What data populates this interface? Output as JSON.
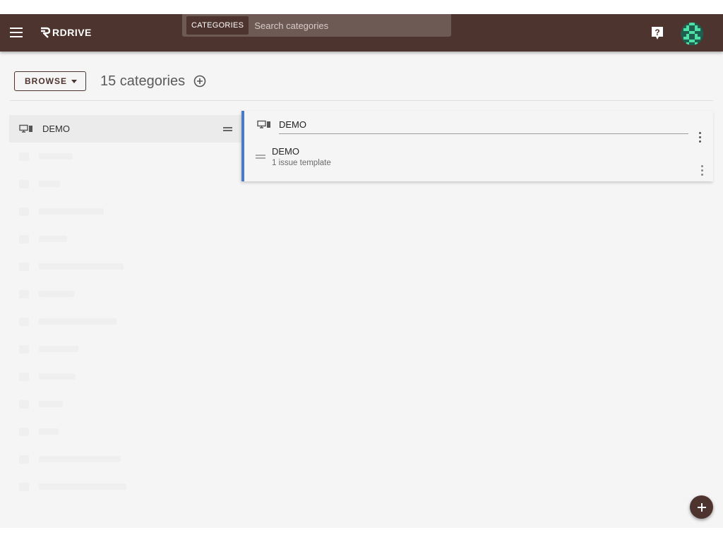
{
  "header": {
    "logo_text": "RDRIVE",
    "search_chip": "CATEGORIES",
    "search_placeholder": "Search categories",
    "search_value": ""
  },
  "toolbar": {
    "browse_label": "BROWSE",
    "count_title": "15 categories"
  },
  "left_list": {
    "selected_item": {
      "label": "DEMO",
      "icon": "device-icon"
    },
    "faded_items_count": 13
  },
  "detail": {
    "name_value": "DEMO",
    "header_icon": "device-icon",
    "templates": [
      {
        "name": "DEMO",
        "subtitle": "1 issue template"
      }
    ]
  },
  "colors": {
    "primary": "#4e342e",
    "accent": "#4a7bc8",
    "background": "#f5f5f5"
  }
}
